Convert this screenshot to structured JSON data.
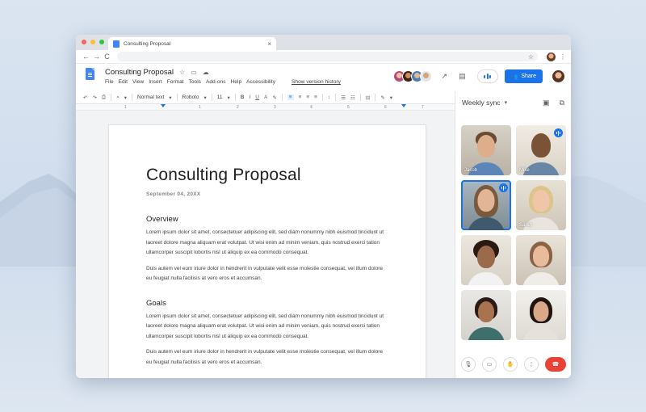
{
  "browser": {
    "tab_title": "Consulting Proposal",
    "tab_close": "×",
    "back": "←",
    "forward": "→",
    "reload": "C",
    "star": "☆",
    "menu": "⋮"
  },
  "doc": {
    "title": "Consulting Proposal",
    "title_icons": [
      "star-icon",
      "folder-icon",
      "cloud-icon"
    ],
    "menu": [
      "File",
      "Edit",
      "View",
      "Insert",
      "Format",
      "Tools",
      "Add-ons",
      "Help",
      "Accessibility"
    ],
    "version_link": "Show version history",
    "share_label": "Share"
  },
  "toolbar": {
    "undo": "↶",
    "redo": "↷",
    "print": "⎙",
    "zoom": "⌕",
    "style": "Normal text",
    "font": "Roboto",
    "size": "11",
    "bold": "B",
    "italic": "I",
    "underline": "U",
    "text_color": "A",
    "highlight": "✎",
    "align_left": "≡",
    "align_center": "≡",
    "align_right": "≡",
    "justify": "≡",
    "line_spacing": "↕",
    "list_bullets": "☰",
    "list_numbers": "☷",
    "clear_format": "⊟",
    "edit_mode": "✎",
    "dropdown_caret": "▾"
  },
  "ruler": {
    "numbers": [
      "1",
      "1",
      "2",
      "3",
      "4",
      "5",
      "6",
      "7"
    ]
  },
  "page": {
    "heading": "Consulting Proposal",
    "date": "September 04, 20XX",
    "section1_heading": "Overview",
    "section1_p1": "Lorem ipsum dolor sit amet, consectetuer adipiscing elit, sed diam nonummy nibh euismod tincidunt ut laoreet dolore magna aliquam erat volutpat. Ut wisi enim ad minim veniam, quis nostrud exerci tation ullamcorper suscipit lobortis nisl ut aliquip ex ea commodo consequat.",
    "section1_p2": "Duis autem vel eum iriure dolor in hendrerit in vulputate velit esse molestie consequat, vel illum dolore eu feugiat nulla facilisis at vero eros et accumsan.",
    "section2_heading": "Goals",
    "section2_p1": "Lorem ipsum dolor sit amet, consectetuer adipiscing elit, sed diam nonummy nibh euismod tincidunt ut laoreet dolore magna aliquam erat volutpat. Ut wisi enim ad minim veniam, quis nostrud exerci tation ullamcorper suscipit lobortis nisl ut aliquip ex ea commodo consequat.",
    "section2_p2": "Duis autem vel eum iriure dolor in hendrerit in vulputate velit esse molestie consequat, vel illum dolore eu feugiat nulla facilisis at vero eros et accumsan."
  },
  "meet": {
    "title": "Weekly sync",
    "caret": "▾",
    "participants": [
      {
        "label": "Jacob",
        "speaking": false,
        "active": false
      },
      {
        "label": "Mike",
        "speaking": true,
        "active": false
      },
      {
        "label": "",
        "speaking": true,
        "active": true
      },
      {
        "label": "Sarah",
        "speaking": false,
        "active": false
      },
      {
        "label": "",
        "speaking": false,
        "active": false
      },
      {
        "label": "",
        "speaking": false,
        "active": false
      },
      {
        "label": "",
        "speaking": false,
        "active": false
      },
      {
        "label": "",
        "speaking": false,
        "active": false
      }
    ],
    "controls": [
      "mic-icon",
      "camera-icon",
      "raise-hand-icon",
      "more-icon",
      "end-call-icon"
    ]
  },
  "colors": {
    "accent": "#1a73e8",
    "end_call": "#ea4335",
    "mac_red": "#ff5f57",
    "mac_yellow": "#febc2e",
    "mac_green": "#28c840"
  }
}
